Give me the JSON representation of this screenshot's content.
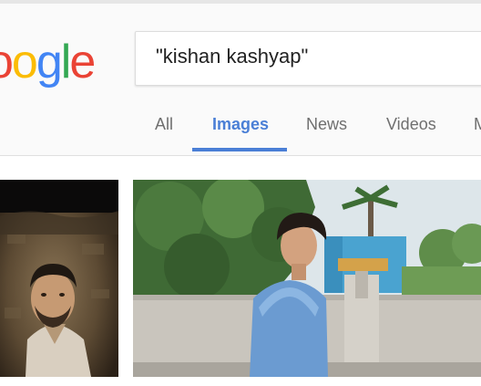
{
  "search": {
    "query": "\"kishan kashyap\""
  },
  "logo": {
    "letters": [
      "o",
      "o",
      "g",
      "l",
      "e"
    ],
    "colors": [
      "#ea4335",
      "#fbbc05",
      "#4285f4",
      "#34a853",
      "#ea4335"
    ]
  },
  "tabs": [
    {
      "label": "All"
    },
    {
      "label": "Images"
    },
    {
      "label": "News"
    },
    {
      "label": "Videos"
    },
    {
      "label": "M"
    }
  ],
  "colors": {
    "accent": "#4a7fd6"
  }
}
